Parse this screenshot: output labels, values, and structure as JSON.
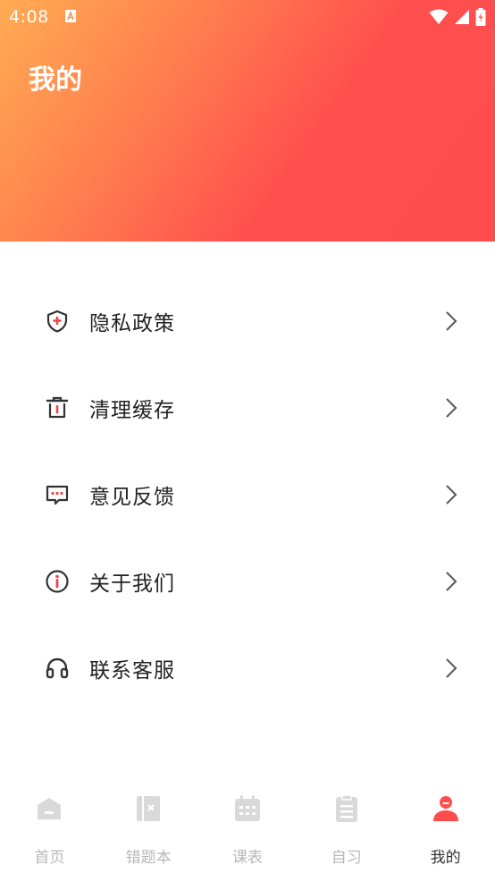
{
  "status_bar": {
    "time": "4:08"
  },
  "header": {
    "title": "我的"
  },
  "menu": {
    "items": [
      {
        "label": "隐私政策",
        "icon": "shield-icon"
      },
      {
        "label": "清理缓存",
        "icon": "trash-icon"
      },
      {
        "label": "意见反馈",
        "icon": "feedback-icon"
      },
      {
        "label": "关于我们",
        "icon": "info-icon"
      },
      {
        "label": "联系客服",
        "icon": "headset-icon"
      }
    ]
  },
  "tabbar": {
    "tabs": [
      {
        "label": "首页",
        "icon": "home-icon",
        "active": false
      },
      {
        "label": "错题本",
        "icon": "notebook-icon",
        "active": false
      },
      {
        "label": "课表",
        "icon": "calendar-icon",
        "active": false
      },
      {
        "label": "自习",
        "icon": "clipboard-icon",
        "active": false
      },
      {
        "label": "我的",
        "icon": "user-icon",
        "active": true
      }
    ]
  },
  "colors": {
    "accent": "#ff4c4c",
    "gradient_start": "#ffac52",
    "gradient_end": "#ff4c4c",
    "tab_inactive": "#d9d9d9",
    "icon_accent": "#f0414a"
  }
}
